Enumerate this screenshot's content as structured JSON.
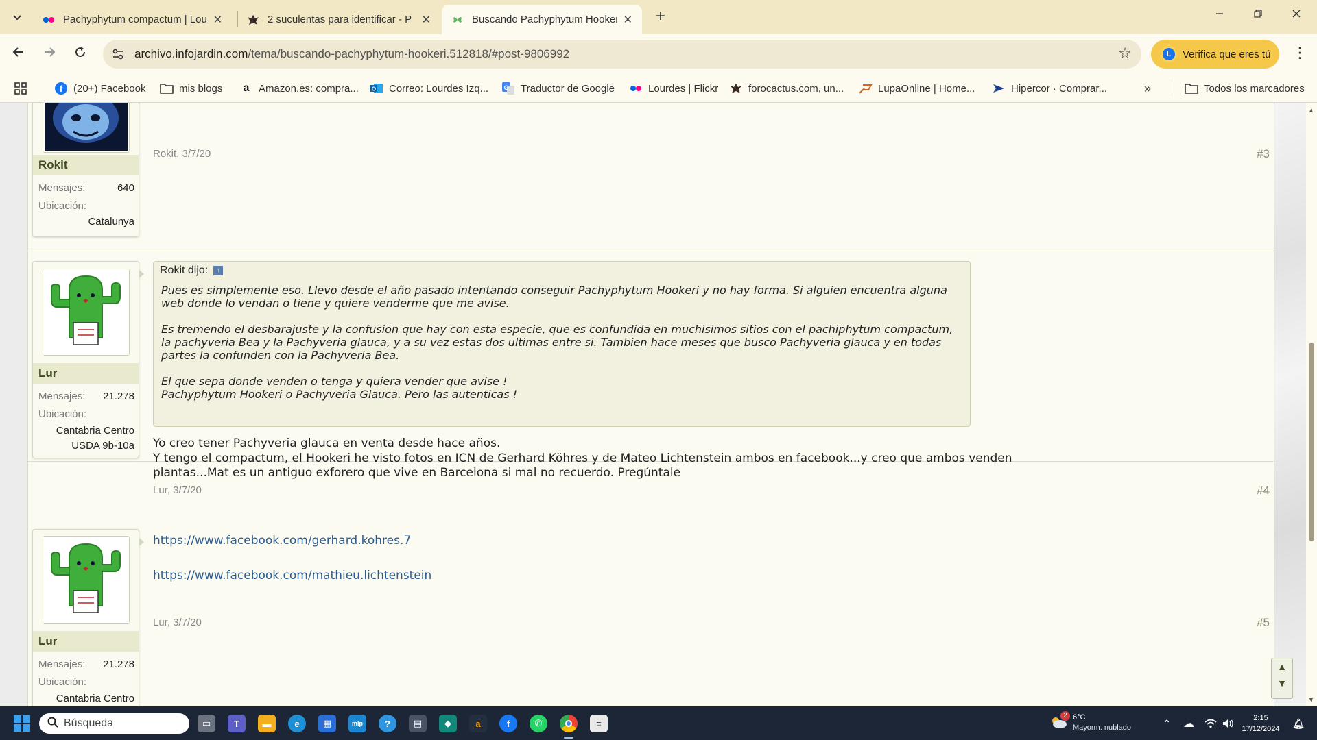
{
  "browser": {
    "tabs": [
      {
        "title": "Pachyphytum compactum | Lou",
        "favicon": "flickr-icon"
      },
      {
        "title": "2 suculentas para identificar - P",
        "favicon": "forocactus-icon"
      },
      {
        "title": "Buscando Pachyphytum Hooker",
        "favicon": "infojardin-icon"
      }
    ],
    "url_host": "archivo.infojardin.com",
    "url_path": "/tema/buscando-pachyphytum-hookeri.512818/#post-9806992",
    "verify_label": "Verifica que eres tú",
    "verify_avatar": "L",
    "bookmarks": [
      {
        "label": "(20+) Facebook",
        "icon": "facebook-icon"
      },
      {
        "label": "mis blogs",
        "icon": "folder-icon"
      },
      {
        "label": "Amazon.es: compra...",
        "icon": "amazon-icon"
      },
      {
        "label": "Correo: Lourdes Izq...",
        "icon": "outlook-icon"
      },
      {
        "label": "Traductor de Google",
        "icon": "translate-icon"
      },
      {
        "label": "Lourdes | Flickr",
        "icon": "flickr-icon"
      },
      {
        "label": "forocactus.com, un...",
        "icon": "forocactus-icon"
      },
      {
        "label": "LupaOnline | Home...",
        "icon": "lupa-icon"
      },
      {
        "label": "Hipercor · Comprar...",
        "icon": "hipercor-icon"
      }
    ],
    "all_bookmarks_label": "Todos los marcadores"
  },
  "posts": [
    {
      "user": "Rokit",
      "stats": {
        "messages_label": "Mensajes:",
        "messages": "640",
        "location_label": "Ubicación:",
        "location_lines": [
          "Catalunya"
        ]
      },
      "meta": "Rokit, 3/7/20",
      "number": "#3"
    },
    {
      "user": "Lur",
      "stats": {
        "messages_label": "Mensajes:",
        "messages": "21.278",
        "location_label": "Ubicación:",
        "location_lines": [
          "Cantabria Centro",
          "USDA 9b-10a"
        ]
      },
      "quote": {
        "author": "Rokit dijo:",
        "paragraphs": [
          "Pues es simplemente eso. Llevo desde el año pasado intentando conseguir Pachyphytum Hookeri y no hay forma. Si alguien encuentra alguna web donde lo vendan o tiene y quiere venderme que me avise.",
          "Es tremendo el desbarajuste y la confusion que hay con esta especie, que es confundida en muchisimos sitios con el pachiphytum compactum, la pachyveria Bea y la Pachyveria glauca, y a su vez estas dos ultimas entre si. Tambien hace meses que busco Pachyveria glauca y en todas partes la confunden con la Pachyveria Bea.",
          "El que sepa donde venden o tenga y quiera vender que avise !\nPachyphytum Hookeri o Pachyveria Glauca. Pero las autenticas !"
        ]
      },
      "body_lines": [
        "Yo creo tener Pachyveria glauca en venta desde hace años.",
        "Y tengo el compactum, el Hookeri he visto fotos en ICN de Gerhard Köhres y de Mateo Lichtenstein ambos en facebook...y creo que ambos venden plantas...Mat es un antiguo exforero que vive en Barcelona si mal no recuerdo. Pregúntale"
      ],
      "meta": "Lur, 3/7/20",
      "number": "#4"
    },
    {
      "user": "Lur",
      "stats": {
        "messages_label": "Mensajes:",
        "messages": "21.278",
        "location_label": "Ubicación:",
        "location_lines": [
          "Cantabria Centro"
        ]
      },
      "links": [
        "https://www.facebook.com/gerhard.kohres.7",
        "https://www.facebook.com/mathieu.lichtenstein"
      ],
      "meta": "Lur, 3/7/20",
      "number": "#5"
    }
  ],
  "scroll_buttons": {
    "up": "▲",
    "down": "▼"
  },
  "taskbar": {
    "search_placeholder": "Búsqueda",
    "weather_temp": "6°C",
    "weather_desc": "Mayorm. nublado",
    "weather_badge": "2",
    "time": "2:15",
    "date": "17/12/2024"
  }
}
